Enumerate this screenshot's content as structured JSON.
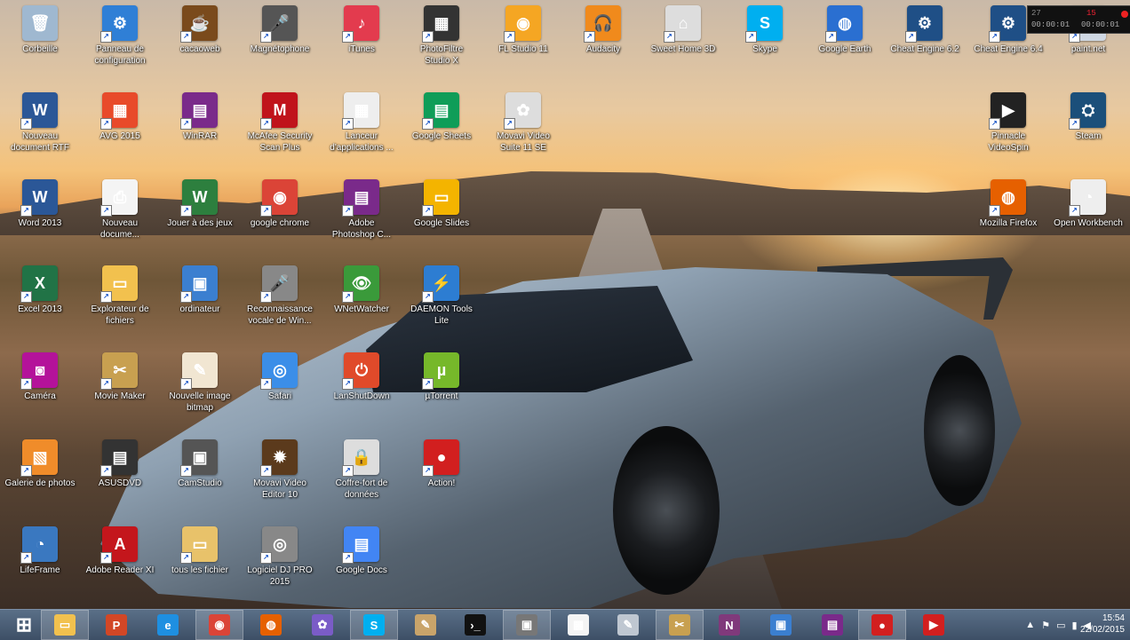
{
  "desktop": {
    "icons": [
      {
        "label": "Corbeille",
        "icon": "recycle-bin-icon",
        "color": "#9fb8d0",
        "glyph": "🗑"
      },
      {
        "label": "Panneau de\nconfiguration",
        "icon": "control-panel-icon",
        "color": "#2f7fd6",
        "glyph": "⚙"
      },
      {
        "label": "cacaoweb",
        "icon": "cacaoweb-icon",
        "color": "#7a4a1c",
        "glyph": "☕"
      },
      {
        "label": "Magnétophone",
        "icon": "microphone-icon",
        "color": "#555",
        "glyph": "🎤"
      },
      {
        "label": "iTunes",
        "icon": "itunes-icon",
        "color": "#e33b4e",
        "glyph": "♪"
      },
      {
        "label": "PhotoFiltre\nStudio X",
        "icon": "photofiltre-icon",
        "color": "#333",
        "glyph": "▦"
      },
      {
        "label": "FL Studio 11",
        "icon": "fl-studio-icon",
        "color": "#f5a623",
        "glyph": "◉"
      },
      {
        "label": "Audacity",
        "icon": "audacity-icon",
        "color": "#f08a1c",
        "glyph": "🎧"
      },
      {
        "label": "Sweet Home 3D",
        "icon": "sweet-home-3d-icon",
        "color": "#ddd",
        "glyph": "⌂"
      },
      {
        "label": "Skype",
        "icon": "skype-icon",
        "color": "#00aff0",
        "glyph": "S"
      },
      {
        "label": "Google Earth",
        "icon": "google-earth-icon",
        "color": "#2a6fd1",
        "glyph": "◍"
      },
      {
        "label": "Cheat Engine 6.2",
        "icon": "cheat-engine-icon",
        "color": "#1f4f86",
        "glyph": "⚙"
      },
      {
        "label": "Cheat Engine 6.4",
        "icon": "cheat-engine-icon",
        "color": "#1f4f86",
        "glyph": "⚙"
      },
      {
        "label": "paint.net",
        "icon": "paint-net-icon",
        "color": "#cfd8e3",
        "glyph": "✎"
      },
      {
        "label": "Nouveau\ndocument RTF",
        "icon": "word-document-icon",
        "color": "#2b5797",
        "glyph": "W"
      },
      {
        "label": "AVG 2015",
        "icon": "avg-icon",
        "color": "#e84a2a",
        "glyph": "▦"
      },
      {
        "label": "WinRAR",
        "icon": "winrar-icon",
        "color": "#7a2a8a",
        "glyph": "▤"
      },
      {
        "label": "McAfee Security\nScan Plus",
        "icon": "mcafee-icon",
        "color": "#c0131b",
        "glyph": "M"
      },
      {
        "label": "Lanceur\nd'applications ...",
        "icon": "app-launcher-icon",
        "color": "#eee",
        "glyph": "▦"
      },
      {
        "label": "Google Sheets",
        "icon": "google-sheets-icon",
        "color": "#0f9d58",
        "glyph": "▤"
      },
      {
        "label": "Movavi Video\nSuite 11 SE",
        "icon": "movavi-suite-icon",
        "color": "#ddd",
        "glyph": "✿"
      },
      {
        "label": "Pinnacle\nVideoSpin",
        "icon": "pinnacle-icon",
        "color": "#222",
        "glyph": "▶"
      },
      {
        "label": "Steam",
        "icon": "steam-icon",
        "color": "#1b4f7a",
        "glyph": "⛭"
      },
      {
        "label": "Word 2013",
        "icon": "word-icon",
        "color": "#2b5797",
        "glyph": "W"
      },
      {
        "label": "Nouveau\ndocume...",
        "icon": "text-document-icon",
        "color": "#f4f4f4",
        "glyph": "⎙"
      },
      {
        "label": "Jouer à des jeux",
        "icon": "wild-games-icon",
        "color": "#2d7f3e",
        "glyph": "W"
      },
      {
        "label": "google chrome",
        "icon": "chrome-icon",
        "color": "#db4437",
        "glyph": "◉"
      },
      {
        "label": "Adobe\nPhotoshop C...",
        "icon": "winrar-icon",
        "color": "#7a2a8a",
        "glyph": "▤"
      },
      {
        "label": "Google Slides",
        "icon": "google-slides-icon",
        "color": "#f4b400",
        "glyph": "▭"
      },
      {
        "label": "Mozilla Firefox",
        "icon": "firefox-icon",
        "color": "#e66000",
        "glyph": "◍"
      },
      {
        "label": "Open Workbench",
        "icon": "open-workbench-icon",
        "color": "#eee",
        "glyph": "◔"
      },
      {
        "label": "Excel 2013",
        "icon": "excel-icon",
        "color": "#217346",
        "glyph": "X"
      },
      {
        "label": "Explorateur de\nfichiers",
        "icon": "folder-icon",
        "color": "#f2c14e",
        "glyph": "▭"
      },
      {
        "label": "ordinateur",
        "icon": "computer-icon",
        "color": "#3b7fd0",
        "glyph": "▣"
      },
      {
        "label": "Reconnaissance\nvocale de Win...",
        "icon": "microphone-icon",
        "color": "#888",
        "glyph": "🎤"
      },
      {
        "label": "WNetWatcher",
        "icon": "network-watcher-icon",
        "color": "#3a9a3a",
        "glyph": "👁"
      },
      {
        "label": "DAEMON Tools\nLite",
        "icon": "daemon-tools-icon",
        "color": "#2d7dd2",
        "glyph": "⚡"
      },
      {
        "label": "Caméra",
        "icon": "camera-icon",
        "color": "#b4129a",
        "glyph": "◙"
      },
      {
        "label": "Movie Maker",
        "icon": "movie-maker-icon",
        "color": "#c8a050",
        "glyph": "✂"
      },
      {
        "label": "Nouvelle image\nbitmap",
        "icon": "bitmap-icon",
        "color": "#f1e6d2",
        "glyph": "✎"
      },
      {
        "label": "Safari",
        "icon": "safari-icon",
        "color": "#3b8ee8",
        "glyph": "◎"
      },
      {
        "label": "LanShutDown",
        "icon": "power-icon",
        "color": "#e04a2a",
        "glyph": "⏻"
      },
      {
        "label": "µTorrent",
        "icon": "utorrent-icon",
        "color": "#76b82a",
        "glyph": "µ"
      },
      {
        "label": "Galerie de photos",
        "icon": "photo-gallery-icon",
        "color": "#f08c2a",
        "glyph": "▧"
      },
      {
        "label": "ASUSDVD",
        "icon": "film-icon",
        "color": "#333",
        "glyph": "▤"
      },
      {
        "label": "CamStudio",
        "icon": "camstudio-icon",
        "color": "#555",
        "glyph": "▣"
      },
      {
        "label": "Movavi Video\nEditor 10",
        "icon": "movavi-editor-icon",
        "color": "#5b3a1c",
        "glyph": "✹"
      },
      {
        "label": "Coffre-fort de\ndonnées",
        "icon": "vault-icon",
        "color": "#ddd",
        "glyph": "🔒"
      },
      {
        "label": "Action!",
        "icon": "action-icon",
        "color": "#d21f1f",
        "glyph": "●"
      },
      {
        "label": "LifeFrame",
        "icon": "lifeframe-icon",
        "color": "#3a78c0",
        "glyph": "◔"
      },
      {
        "label": "Adobe Reader XI",
        "icon": "adobe-reader-icon",
        "color": "#c4161c",
        "glyph": "A"
      },
      {
        "label": "tous les fichier",
        "icon": "folder-icon",
        "color": "#e8c26a",
        "glyph": "▭"
      },
      {
        "label": "Logiciel DJ PRO\n2015",
        "icon": "speaker-icon",
        "color": "#888",
        "glyph": "◎"
      },
      {
        "label": "Google Docs",
        "icon": "google-docs-icon",
        "color": "#4285f4",
        "glyph": "▤"
      }
    ]
  },
  "recorder_hud": {
    "t1": "27",
    "t2": "00:00:01",
    "t3": "15",
    "t4": "00:00:01"
  },
  "taskbar": {
    "items": [
      {
        "name": "start-button",
        "glyph": "⊞",
        "color": "transparent",
        "active": false
      },
      {
        "name": "file-explorer-taskbar",
        "glyph": "▭",
        "color": "#f2c14e",
        "active": true
      },
      {
        "name": "powerpoint-taskbar",
        "glyph": "P",
        "color": "#d24726",
        "active": false
      },
      {
        "name": "internet-explorer-taskbar",
        "glyph": "e",
        "color": "#1e8fe1",
        "active": false
      },
      {
        "name": "chrome-taskbar",
        "glyph": "◉",
        "color": "#db4437",
        "active": true
      },
      {
        "name": "firefox-taskbar",
        "glyph": "◍",
        "color": "#e66000",
        "active": false
      },
      {
        "name": "picasa-taskbar",
        "glyph": "✿",
        "color": "#7a5cc7",
        "active": false
      },
      {
        "name": "skype-taskbar",
        "glyph": "S",
        "color": "#00aff0",
        "active": true
      },
      {
        "name": "document-taskbar",
        "glyph": "✎",
        "color": "#c9a46a",
        "active": false
      },
      {
        "name": "cmd-taskbar",
        "glyph": "›_",
        "color": "#111",
        "active": false
      },
      {
        "name": "camstudio-taskbar",
        "glyph": "▣",
        "color": "#777",
        "active": true
      },
      {
        "name": "app-launcher-taskbar",
        "glyph": "▦",
        "color": "#f4f4f4",
        "active": false
      },
      {
        "name": "paint-taskbar",
        "glyph": "✎",
        "color": "#bfc7d1",
        "active": false
      },
      {
        "name": "movie-maker-taskbar",
        "glyph": "✂",
        "color": "#c8a050",
        "active": true
      },
      {
        "name": "onenote-taskbar",
        "glyph": "N",
        "color": "#80397b",
        "active": false
      },
      {
        "name": "monitor-taskbar",
        "glyph": "▣",
        "color": "#3b7fd0",
        "active": false
      },
      {
        "name": "winrar-taskbar",
        "glyph": "▤",
        "color": "#7a2a8a",
        "active": false
      },
      {
        "name": "record-taskbar",
        "glyph": "●",
        "color": "#d21f1f",
        "active": true
      },
      {
        "name": "action-taskbar",
        "glyph": "▶",
        "color": "#d21f1f",
        "active": false
      }
    ],
    "clock_time": "15:54",
    "clock_date": "22/02/2015"
  }
}
